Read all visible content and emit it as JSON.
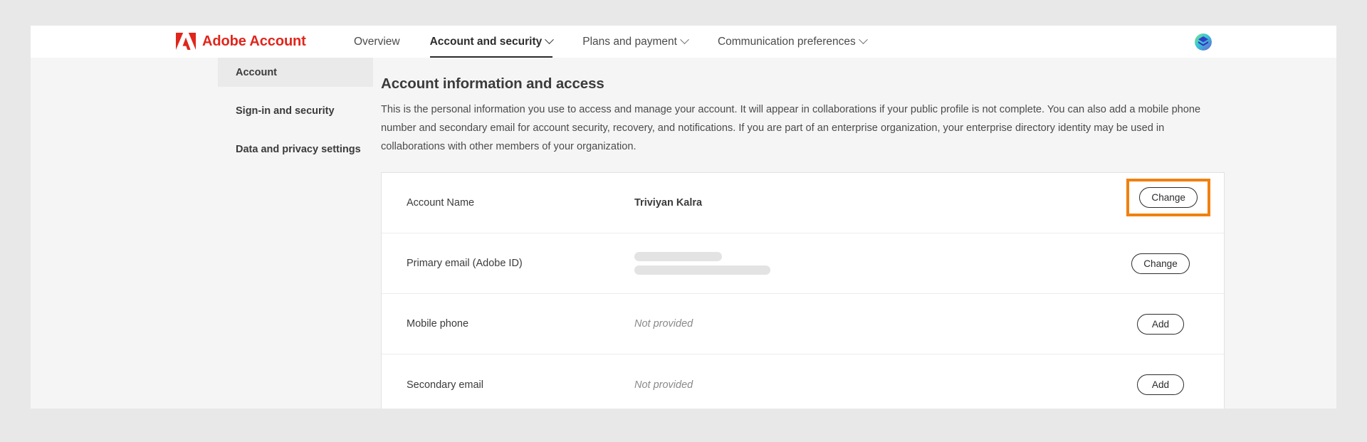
{
  "brand": {
    "name": "Adobe Account",
    "logo_icon": "adobe-logo",
    "logo_color": "#e1251b"
  },
  "topnav": {
    "items": [
      {
        "label": "Overview",
        "has_chevron": false,
        "active": false
      },
      {
        "label": "Account and security",
        "has_chevron": true,
        "active": true
      },
      {
        "label": "Plans and payment",
        "has_chevron": true,
        "active": false
      },
      {
        "label": "Communication preferences",
        "has_chevron": true,
        "active": false
      }
    ],
    "avatar_icon": "user-avatar"
  },
  "sidebar": {
    "items": [
      {
        "label": "Account",
        "selected": true
      },
      {
        "label": "Sign-in and security",
        "selected": false
      },
      {
        "label": "Data and privacy settings",
        "selected": false
      }
    ]
  },
  "main": {
    "title": "Account information and access",
    "description": "This is the personal information you use to access and manage your account. It will appear in collaborations if your public profile is not complete. You can also add a mobile phone number and secondary email for account security, recovery, and notifications. If you are part of an enterprise organization, your enterprise directory identity may be used in collaborations with other members of your organization.",
    "rows": [
      {
        "label": "Account Name",
        "value": "Triviyan Kalra",
        "value_style": "bold",
        "action_label": "Change",
        "highlighted": true
      },
      {
        "label": "Primary email (Adobe ID)",
        "value": "",
        "value_style": "redacted",
        "action_label": "Change",
        "highlighted": false
      },
      {
        "label": "Mobile phone",
        "value": "Not provided",
        "value_style": "muted",
        "action_label": "Add",
        "highlighted": false
      },
      {
        "label": "Secondary email",
        "value": "Not provided",
        "value_style": "muted",
        "action_label": "Add",
        "highlighted": false
      }
    ]
  },
  "colors": {
    "adobe_red": "#e1251b",
    "highlight_orange": "#f08010",
    "page_background": "#f5f5f5",
    "card_background": "#ffffff"
  }
}
